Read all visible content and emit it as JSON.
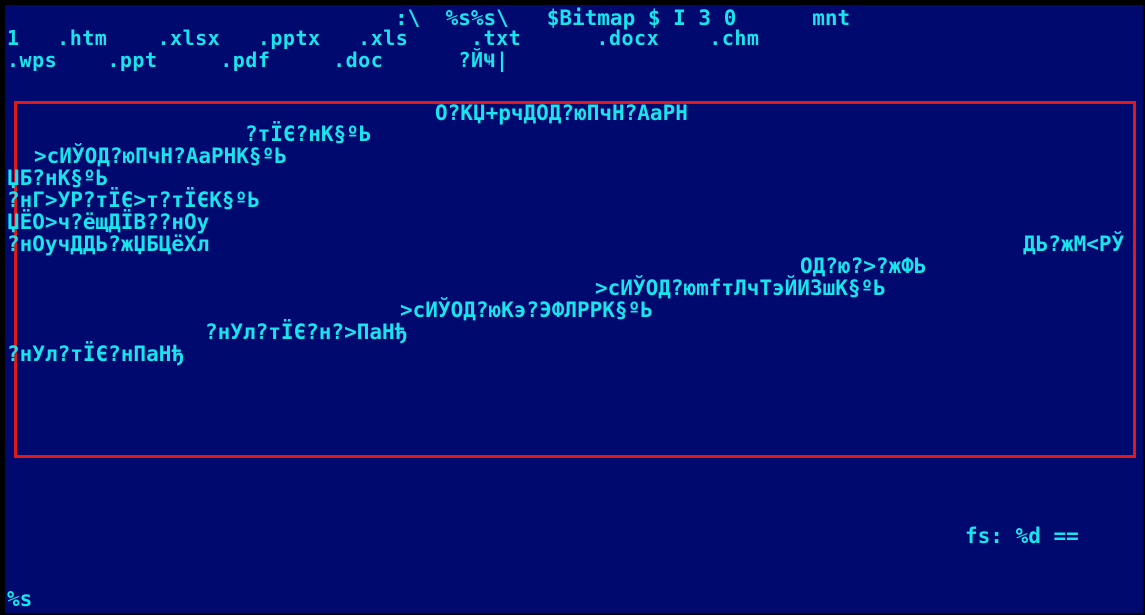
{
  "header": {
    "path_line": ":\\  %s%s\\   $Bitmap $ I 3 0      mnt",
    "extensions_row1": "1   .htm    .xlsx   .pptx   .xls     .txt      .docx    .chm",
    "extensions_row2": ".wps    .ppt     .pdf     .doc      ?ЙҸ|"
  },
  "selection": {
    "border_color": "#e01818",
    "lines": [
      "О?КЏ+рчДОД?юПчН?АаРН",
      "?тЇЄ?нК§ºЬ",
      ">сИЎОД?юПчН?АаРНК§ºЬ",
      "ЏБ?нК§ºЬ",
      "?нГ>УР?тЇЄ>т?тЇЄК§ºЬ",
      "ЏЁО>ч?ёщДЇВ??нОу",
      "?нОучДДЬ?жЏБЦёХл",
      "ДЬ?жМ<РЎ",
      "ОД?ю?>?жФЬ",
      ">сИЎОД?юmfтЛчТэЙИЗшК§ºЬ",
      ">сИЎОД?юКэ?ЭФЛРРК§ºЬ",
      "?нУл?тЇЄ?н?>ПаНђ",
      "?нУл?тЇЄ?нПаНђ"
    ]
  },
  "status": {
    "fs_text": "fs: %d ==",
    "prompt": "%s"
  },
  "colors": {
    "background": "#000a6e",
    "text": "#19e3ec",
    "frame": "#000000"
  }
}
